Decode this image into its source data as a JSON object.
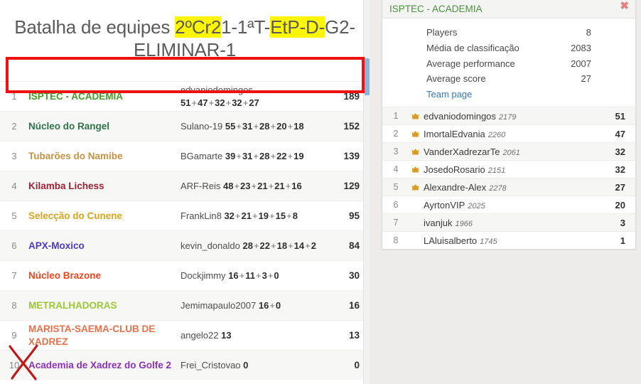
{
  "tournament": {
    "title_parts": [
      {
        "text": "Batalha de equipes ",
        "highlight": false
      },
      {
        "text": "2ºCr2",
        "highlight": true
      },
      {
        "text": "1-1ªT-",
        "highlight": false
      },
      {
        "text": "EtP-D-",
        "highlight": true
      },
      {
        "text": "G2-ELIMINAR-1",
        "highlight": false
      }
    ],
    "title_text": "Batalha de equipes 2ºCr21-1ªT-EtP-D-G2-ELIMINAR-1"
  },
  "leaderboard": {
    "rows": [
      {
        "rank": "1",
        "team": "ISPTEC - ACADEMIA",
        "team_color": "#3f9e22",
        "player": "edvaniodomingos",
        "scores": [
          "51",
          "47",
          "32",
          "32",
          "27"
        ],
        "total": "189",
        "highlighted": true
      },
      {
        "rank": "2",
        "team": "Núcleo do Rangel",
        "team_color": "#2f7349",
        "player": "Sulano-19",
        "scores": [
          "55",
          "31",
          "28",
          "20",
          "18"
        ],
        "total": "152",
        "highlighted": false
      },
      {
        "rank": "3",
        "team": "Tubarões do Namibe",
        "team_color": "#c79243",
        "player": "BGamarte",
        "scores": [
          "39",
          "31",
          "28",
          "22",
          "19"
        ],
        "total": "139",
        "highlighted": false
      },
      {
        "rank": "4",
        "team": "Kilamba Lichess",
        "team_color": "#9e2234",
        "player": "ARF-Reis",
        "scores": [
          "48",
          "23",
          "21",
          "21",
          "16"
        ],
        "total": "129",
        "highlighted": false
      },
      {
        "rank": "5",
        "team": "Selecção do Cunene",
        "team_color": "#d9a521",
        "player": "FrankLin8",
        "scores": [
          "32",
          "21",
          "19",
          "15",
          "8"
        ],
        "total": "95",
        "highlighted": false
      },
      {
        "rank": "6",
        "team": "APX-Moxico",
        "team_color": "#5038c4",
        "player": "kevin_donaldo",
        "scores": [
          "28",
          "22",
          "18",
          "14",
          "2"
        ],
        "total": "84",
        "highlighted": false
      },
      {
        "rank": "7",
        "team": "Núcleo Brazone",
        "team_color": "#ef4520",
        "player": "Dockjimmy",
        "scores": [
          "16",
          "11",
          "3",
          "0"
        ],
        "total": "30",
        "highlighted": false
      },
      {
        "rank": "8",
        "team": "METRALHADORAS",
        "team_color": "#9bc933",
        "player": "Jemimapaulo2007",
        "scores": [
          "16",
          "0"
        ],
        "total": "16",
        "highlighted": false
      },
      {
        "rank": "9",
        "team": "MARISTA-SAEMA-CLUB DE XADREZ",
        "team_color": "#e8704a",
        "player": "angelo22",
        "scores": [
          "13"
        ],
        "total": "13",
        "highlighted": false
      },
      {
        "rank": "10",
        "team": "Academia de Xadrez do Golfe 2",
        "team_color": "#8e2fb8",
        "player": "Frei_Cristovao",
        "scores": [
          "0"
        ],
        "total": "0",
        "highlighted": false
      }
    ]
  },
  "annotations": {
    "red_box_color": "#ee1111",
    "red_x_color": "#c01818",
    "highlighter_color": "#fff600",
    "red_box_target": "rank-1-row",
    "red_x_target": "rank-10-number"
  },
  "team_panel": {
    "team_name": "ISPTEC - ACADEMIA",
    "team_name_color": "#4a8f3b",
    "close_label": "✖",
    "stats": [
      {
        "label": "Players",
        "value": "8"
      },
      {
        "label": "Média de classificação",
        "value": "2083"
      },
      {
        "label": "Average performance",
        "value": "2007"
      },
      {
        "label": "Average score",
        "value": "27"
      }
    ],
    "team_page_label": "Team page",
    "players": [
      {
        "rank": "1",
        "name": "edvaniodomingos",
        "rating": "2179",
        "score": "51",
        "patron": true
      },
      {
        "rank": "2",
        "name": "ImortalEdvania",
        "rating": "2260",
        "score": "47",
        "patron": true
      },
      {
        "rank": "3",
        "name": "VanderXadrezarTe",
        "rating": "2061",
        "score": "32",
        "patron": true
      },
      {
        "rank": "4",
        "name": "JosedoRosario",
        "rating": "2151",
        "score": "32",
        "patron": true
      },
      {
        "rank": "5",
        "name": "Alexandre-Alex",
        "rating": "2278",
        "score": "27",
        "patron": true
      },
      {
        "rank": "6",
        "name": "AyrtonVIP",
        "rating": "2025",
        "score": "20",
        "patron": false
      },
      {
        "rank": "7",
        "name": "ivanjuk",
        "rating": "1966",
        "score": "3",
        "patron": false
      },
      {
        "rank": "8",
        "name": "LAluisalberto",
        "rating": "1745",
        "score": "1",
        "patron": false
      }
    ]
  }
}
